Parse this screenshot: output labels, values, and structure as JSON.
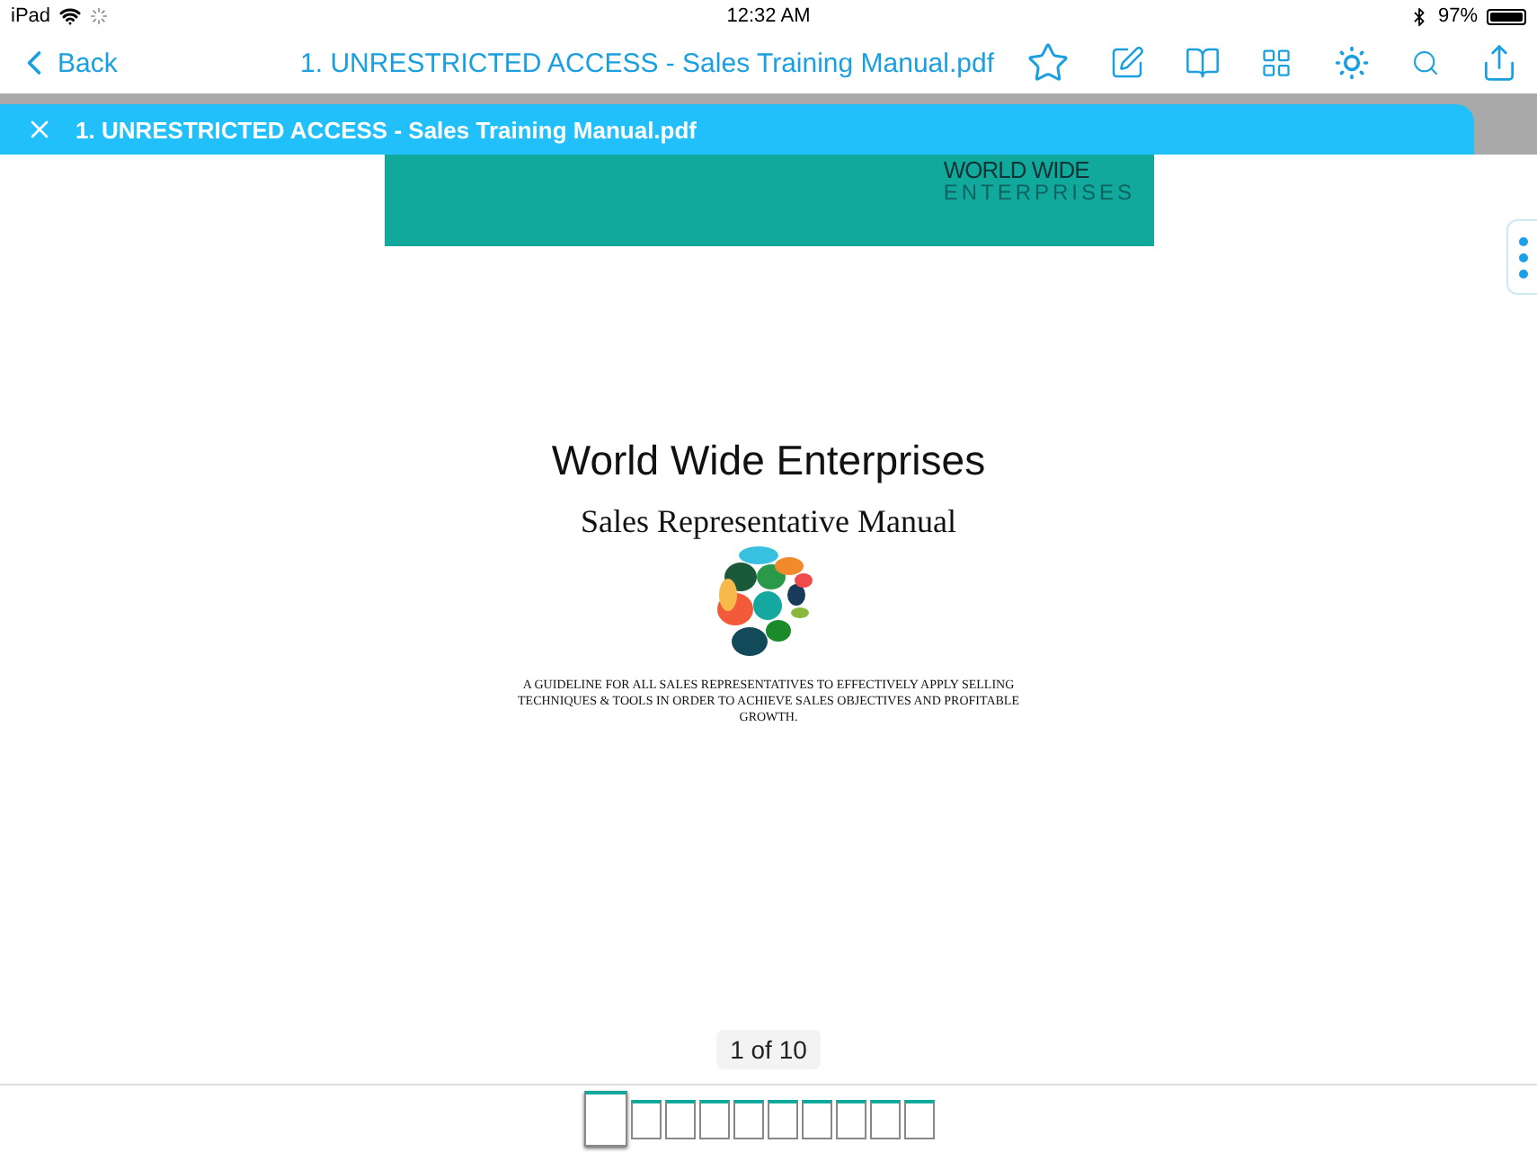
{
  "status_bar": {
    "device": "iPad",
    "time": "12:32 AM",
    "battery": "97%"
  },
  "nav_bar": {
    "back": "Back",
    "title": "1. UNRESTRICTED ACCESS - Sales Training Manual.pdf"
  },
  "tab": {
    "title": "1. UNRESTRICTED ACCESS - Sales Training Manual.pdf"
  },
  "document": {
    "banner_logo": {
      "line_1": "WORLD WIDE",
      "line_2": "ENTERPRISES"
    },
    "title": "World Wide Enterprises",
    "subtitle": "Sales Representative Manual",
    "tagline": "A GUIDELINE FOR ALL SALES REPRESENTATIVES TO EFFECTIVELY APPLY SELLING TECHNIQUES & TOOLS IN ORDER TO ACHIEVE SALES OBJECTIVES AND PROFITABLE GROWTH."
  },
  "page_indicator": "1 of 10",
  "thumbnails": [
    {
      "selected": true
    },
    {
      "selected": false
    },
    {
      "selected": false
    },
    {
      "selected": false
    },
    {
      "selected": false
    },
    {
      "selected": false
    },
    {
      "selected": false
    },
    {
      "selected": false
    },
    {
      "selected": false
    },
    {
      "selected": false
    }
  ]
}
